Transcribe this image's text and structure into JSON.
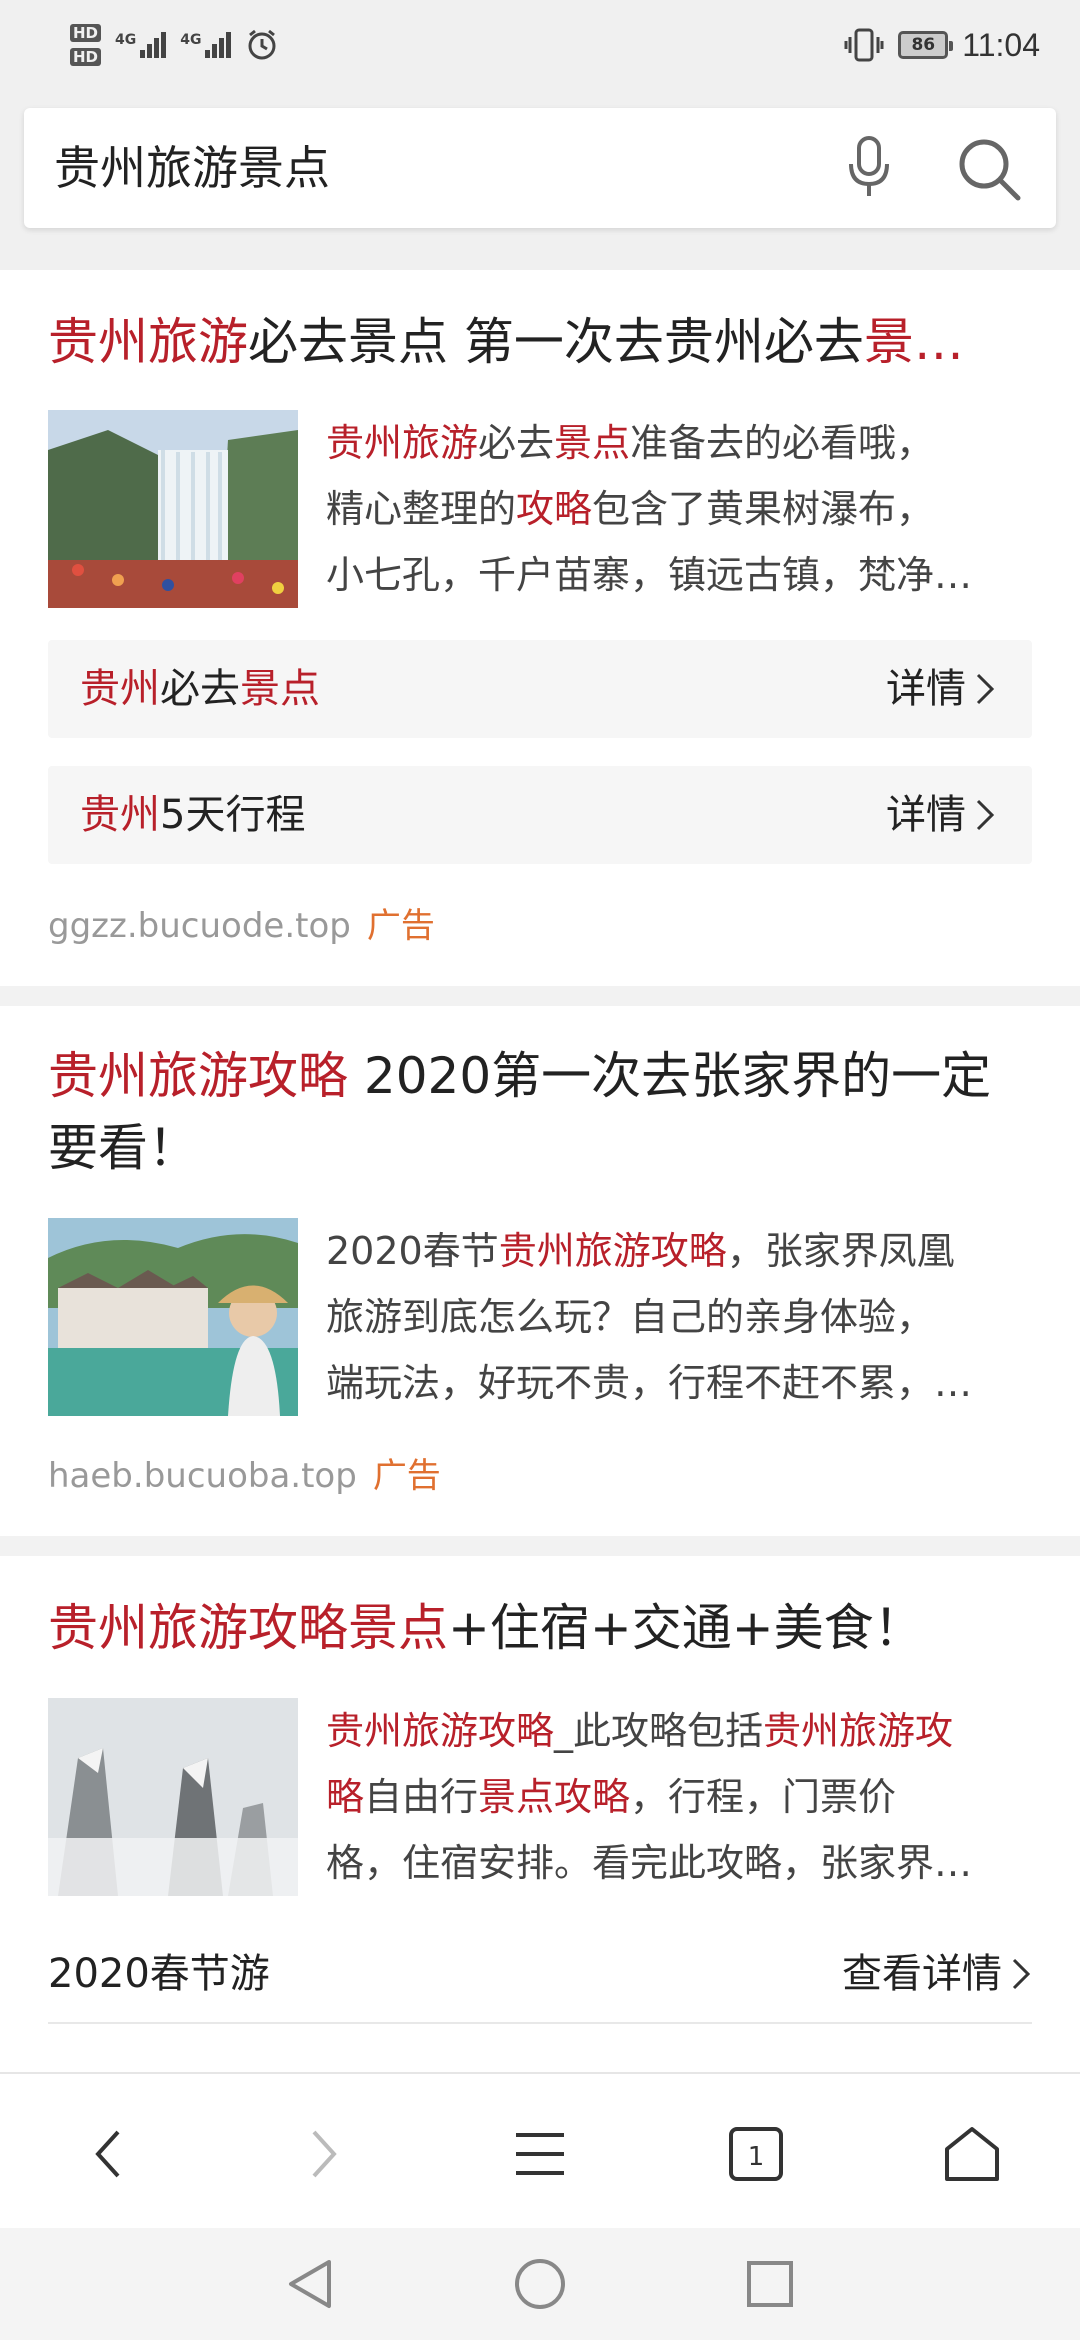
{
  "status_bar": {
    "sim1": "HD",
    "sim2": "HD",
    "net1": "4G",
    "net2": "4G",
    "battery": "86",
    "time": "11:04",
    "icons": [
      "alarm-icon",
      "vibrate-icon",
      "battery-icon"
    ]
  },
  "search": {
    "query": "贵州旅游景点",
    "icons": [
      "microphone-icon",
      "search-icon"
    ]
  },
  "results": [
    {
      "title_parts": [
        {
          "text": "贵州旅游",
          "hl": true
        },
        {
          "text": "必去景点 第一次去贵州必去",
          "hl": false
        },
        {
          "text": "景…",
          "hl": true
        }
      ],
      "desc_lines": [
        [
          {
            "text": "贵州旅游",
            "hl": true
          },
          {
            "text": "必去",
            "hl": false
          },
          {
            "text": "景点",
            "hl": true
          },
          {
            "text": "准备去的必看哦，",
            "hl": false
          }
        ],
        [
          {
            "text": "精心整理的",
            "hl": false
          },
          {
            "text": "攻略",
            "hl": true
          },
          {
            "text": "包含了黄果树瀑布，",
            "hl": false
          }
        ],
        [
          {
            "text": "小七孔，千户苗寨，镇远古镇，梵净…",
            "hl": false
          }
        ]
      ],
      "sublinks": [
        {
          "parts": [
            {
              "text": "贵州",
              "hl": true
            },
            {
              "text": "必去",
              "hl": false
            },
            {
              "text": "景点",
              "hl": true
            }
          ],
          "action": "详情"
        },
        {
          "parts": [
            {
              "text": "贵州",
              "hl": true
            },
            {
              "text": "5天行程",
              "hl": false
            }
          ],
          "action": "详情"
        }
      ],
      "url": "ggzz.bucuode.top",
      "ad_label": "广告"
    },
    {
      "title_parts": [
        {
          "text": "贵州旅游攻略",
          "hl": true
        },
        {
          "text": " 2020第一次去张家界的一定要看！",
          "hl": false
        }
      ],
      "desc_lines": [
        [
          {
            "text": "2020春节",
            "hl": false
          },
          {
            "text": "贵州旅游攻略",
            "hl": true
          },
          {
            "text": "，张家界凤凰",
            "hl": false
          }
        ],
        [
          {
            "text": "旅游到底怎么玩？自己的亲身体验，",
            "hl": false
          }
        ],
        [
          {
            "text": "端玩法，好玩不贵，行程不赶不累，…",
            "hl": false
          }
        ]
      ],
      "url": "haeb.bucuoba.top",
      "ad_label": "广告"
    },
    {
      "title_parts": [
        {
          "text": "贵州旅游攻略景点",
          "hl": true
        },
        {
          "text": "+住宿+交通+美食！",
          "hl": false
        }
      ],
      "desc_lines": [
        [
          {
            "text": "贵州旅游攻略",
            "hl": true
          },
          {
            "text": "_此攻略包括",
            "hl": false
          },
          {
            "text": "贵州旅游攻",
            "hl": true
          }
        ],
        [
          {
            "text": "略",
            "hl": true
          },
          {
            "text": "自由行",
            "hl": false
          },
          {
            "text": "景点攻略",
            "hl": true
          },
          {
            "text": "，行程，门票价",
            "hl": false
          }
        ],
        [
          {
            "text": "格，住宿安排。看完此攻略，张家界…",
            "hl": false
          }
        ]
      ],
      "footer_left": "2020春节游",
      "footer_right": "查看详情"
    }
  ],
  "toolbar": {
    "tab_count": "1",
    "icons": [
      "back-icon",
      "forward-icon",
      "menu-icon",
      "tabs-icon",
      "home-icon"
    ]
  },
  "navbar": {
    "icons": [
      "nav-back-icon",
      "nav-home-icon",
      "nav-recents-icon"
    ]
  },
  "colors": {
    "highlight": "#b8202a",
    "ad": "#e07030",
    "url": "#999999"
  }
}
